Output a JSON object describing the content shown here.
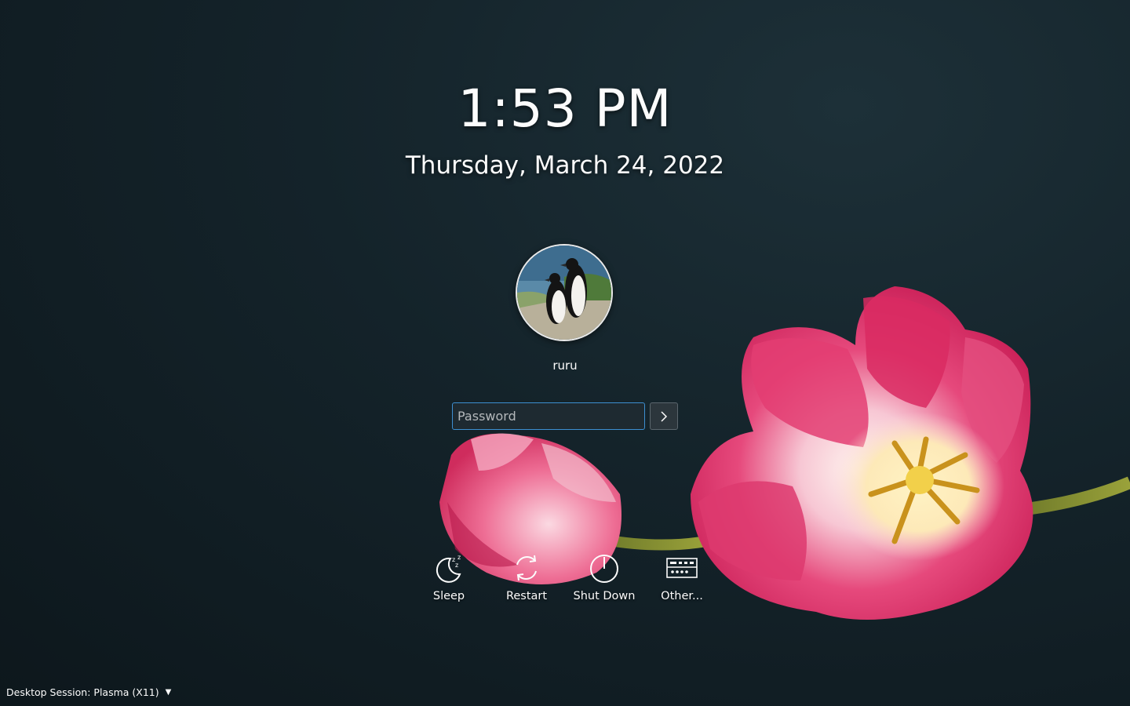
{
  "clock": {
    "time": "1:53 PM",
    "date": "Thursday, March 24, 2022"
  },
  "user": {
    "name": "ruru",
    "avatar_icon": "penguins-avatar-icon"
  },
  "login": {
    "password_placeholder": "Password",
    "submit_icon": "chevron-right-icon"
  },
  "actions": [
    {
      "label": "Sleep",
      "icon": "sleep-icon"
    },
    {
      "label": "Restart",
      "icon": "restart-icon"
    },
    {
      "label": "Shut Down",
      "icon": "power-icon"
    },
    {
      "label": "Other...",
      "icon": "keyboard-icon"
    }
  ],
  "session": {
    "label": "Desktop Session: Plasma (X11)",
    "icon": "dropdown-caret-icon"
  },
  "colors": {
    "background": "#14232a",
    "accent": "#3d8fd1",
    "text": "#fcfcfc",
    "tulip_pink": "#e0386a"
  }
}
